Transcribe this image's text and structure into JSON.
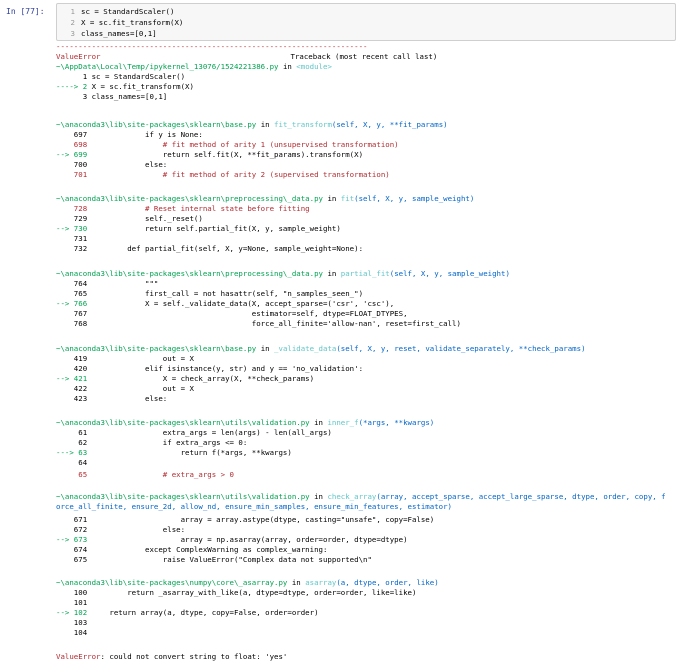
{
  "prompt": "In [77]:",
  "input_cell": {
    "lines": [
      {
        "n": "1",
        "code": "sc = StandardScaler()"
      },
      {
        "n": "2",
        "code": "X = sc.fit_transform(X)"
      },
      {
        "n": "3",
        "code": "class_names=[0,1]"
      }
    ]
  },
  "traceback": {
    "separator": "----------------------------------------------------------------------",
    "error_type": "ValueError",
    "header_right": "Traceback (most recent call last)",
    "frame0_file": "~\\AppData\\Local\\Temp/ipykernel_13076/1524221386.py",
    "frame0_in": "in",
    "frame0_module": "<module>",
    "frame0_l1": "      1 sc = StandardScaler()",
    "frame0_arrow": "----> 2",
    "frame0_l2": " X = sc.fit_transform(X)",
    "frame0_l3": "      3 class_names=[0,1]",
    "f1_file": "~\\anaconda3\\lib\\site-packages\\sklearn\\base.py",
    "f1_func": "fit_transform",
    "f1_sig": "(self, X, y, **fit_params)",
    "f1_l697": "    697             if y is None:",
    "f1_l698": "    698                 # fit method of arity 1 (unsupervised transformation)",
    "f1_arrow": "--> 699",
    "f1_l699": "                 return self.fit(X, **fit_params).transform(X)",
    "f1_l700": "    700             else:",
    "f1_l701": "    701                 # fit method of arity 2 (supervised transformation)",
    "f2_file": "~\\anaconda3\\lib\\site-packages\\sklearn\\preprocessing\\_data.py",
    "f2_func": "fit",
    "f2_sig": "(self, X, y, sample_weight)",
    "f2_l728": "    728             # Reset internal state before fitting",
    "f2_l729": "    729             self._reset()",
    "f2_arrow": "--> 730",
    "f2_l730": "             return self.partial_fit(X, y, sample_weight)",
    "f2_l731": "    731",
    "f2_l732": "    732         def partial_fit(self, X, y=None, sample_weight=None):",
    "f3_file": "~\\anaconda3\\lib\\site-packages\\sklearn\\preprocessing\\_data.py",
    "f3_func": "partial_fit",
    "f3_sig": "(self, X, y, sample_weight)",
    "f3_l764": "    764             \"\"\"",
    "f3_l765": "    765             first_call = not hasattr(self, \"n_samples_seen_\")",
    "f3_arrow": "--> 766",
    "f3_l766": "             X = self._validate_data(X, accept_sparse=('csr', 'csc'),",
    "f3_l767": "    767                                     estimator=self, dtype=FLOAT_DTYPES,",
    "f3_l768": "    768                                     force_all_finite='allow-nan', reset=first_call)",
    "f4_file": "~\\anaconda3\\lib\\site-packages\\sklearn\\base.py",
    "f4_func": "_validate_data",
    "f4_sig": "(self, X, y, reset, validate_separately, **check_params)",
    "f4_l419": "    419                 out = X",
    "f4_l420": "    420             elif isinstance(y, str) and y == 'no_validation':",
    "f4_arrow": "--> 421",
    "f4_l421": "                 X = check_array(X, **check_params)",
    "f4_l422": "    422                 out = X",
    "f4_l423": "    423             else:",
    "f5_file": "~\\anaconda3\\lib\\site-packages\\sklearn\\utils\\validation.py",
    "f5_func": "inner_f",
    "f5_sig": "(*args, **kwargs)",
    "f5_l61": "     61                 extra_args = len(args) - len(all_args)",
    "f5_l62": "     62                 if extra_args <= 0:",
    "f5_arrow": "---> 63",
    "f5_l63": "                     return f(*args, **kwargs)",
    "f5_l64": "     64",
    "f5_l65": "     65                 # extra_args > 0",
    "f6_file": "~\\anaconda3\\lib\\site-packages\\sklearn\\utils\\validation.py",
    "f6_func": "check_array",
    "f6_sig": "(array, accept_sparse, accept_large_sparse, dtype, order, copy, force_all_finite, ensure_2d, allow_nd, ensure_min_samples, ensure_min_features, estimator)",
    "f6_l671": "    671                     array = array.astype(dtype, casting=\"unsafe\", copy=False)",
    "f6_l672": "    672                 else:",
    "f6_arrow": "--> 673",
    "f6_l673": "                     array = np.asarray(array, order=order, dtype=dtype)",
    "f6_l674": "    674             except ComplexWarning as complex_warning:",
    "f6_l675": "    675                 raise ValueError(\"Complex data not supported\\n\"",
    "f7_file": "~\\anaconda3\\lib\\site-packages\\numpy\\core\\_asarray.py",
    "f7_func": "asarray",
    "f7_sig": "(a, dtype, order, like)",
    "f7_l100": "    100         return _asarray_with_like(a, dtype=dtype, order=order, like=like)",
    "f7_l101": "    101",
    "f7_arrow": "--> 102",
    "f7_l102": "     return array(a, dtype, copy=False, order=order)",
    "f7_l103": "    103",
    "f7_l104": "    104",
    "final_type": "ValueError",
    "final_msg": ": could not convert string to float: 'yes'"
  }
}
